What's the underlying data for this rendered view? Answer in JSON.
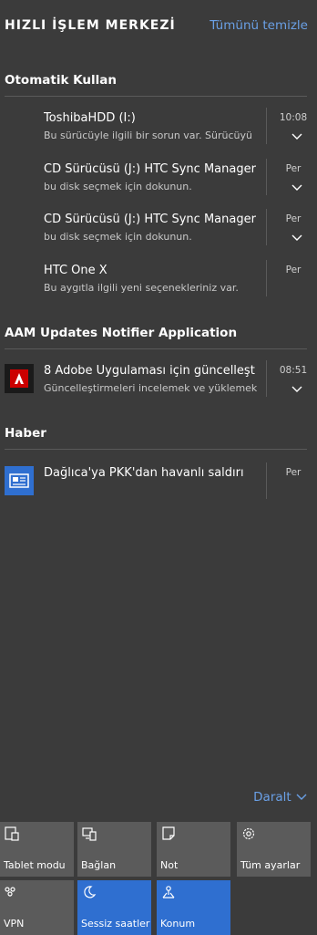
{
  "header": {
    "title": "HIZLI İŞLEM MERKEZİ",
    "clear_all": "Tümünü temizle"
  },
  "groups": [
    {
      "title": "Otomatik Kullan",
      "notifications": [
        {
          "title": "ToshibaHDD (I:)",
          "body": "Bu sürücüyle ilgili bir sorun var. Sürücüyü",
          "time": "10:08"
        },
        {
          "title": "CD Sürücüsü (J:) HTC Sync Manager",
          "body": "bu disk seçmek için dokunun.",
          "time": "Per"
        },
        {
          "title": "CD Sürücüsü (J:) HTC Sync Manager",
          "body": "bu disk seçmek için dokunun.",
          "time": "Per"
        },
        {
          "title": "HTC One X",
          "body": "Bu aygıtla ilgili yeni seçenekleriniz var.",
          "time": "Per"
        }
      ]
    },
    {
      "title": "AAM Updates Notifier Application",
      "notifications": [
        {
          "title": "8 Adobe Uygulaması için güncelleşt",
          "body": "Güncelleştirmeleri incelemek ve yüklemek",
          "time": "08:51",
          "icon": "adobe-icon"
        }
      ]
    },
    {
      "title": "Haber",
      "notifications": [
        {
          "title": "Dağlıca'ya PKK'dan havanlı saldırı",
          "time": "Per",
          "icon": "news-icon"
        }
      ]
    }
  ],
  "collapse_label": "Daralt",
  "quick_actions": [
    {
      "label": "Tablet modu",
      "icon": "tablet-mode-icon",
      "active": false
    },
    {
      "label": "Bağlan",
      "icon": "connect-icon",
      "active": false
    },
    {
      "label": "Not",
      "icon": "note-icon",
      "active": false
    },
    {
      "label": "Tüm ayarlar",
      "icon": "gear-icon",
      "active": false
    },
    {
      "label": "VPN",
      "icon": "vpn-icon",
      "active": false
    },
    {
      "label": "Sessiz saatler",
      "icon": "moon-icon",
      "active": true
    },
    {
      "label": "Konum",
      "icon": "location-icon",
      "active": true
    }
  ],
  "colors": {
    "background": "#3b3b3b",
    "accent": "#2f6fd0",
    "link": "#6aa0e6",
    "tile": "#5b5b5b",
    "adobe_red": "#cc0000",
    "news_blue": "#2f6fd0"
  }
}
